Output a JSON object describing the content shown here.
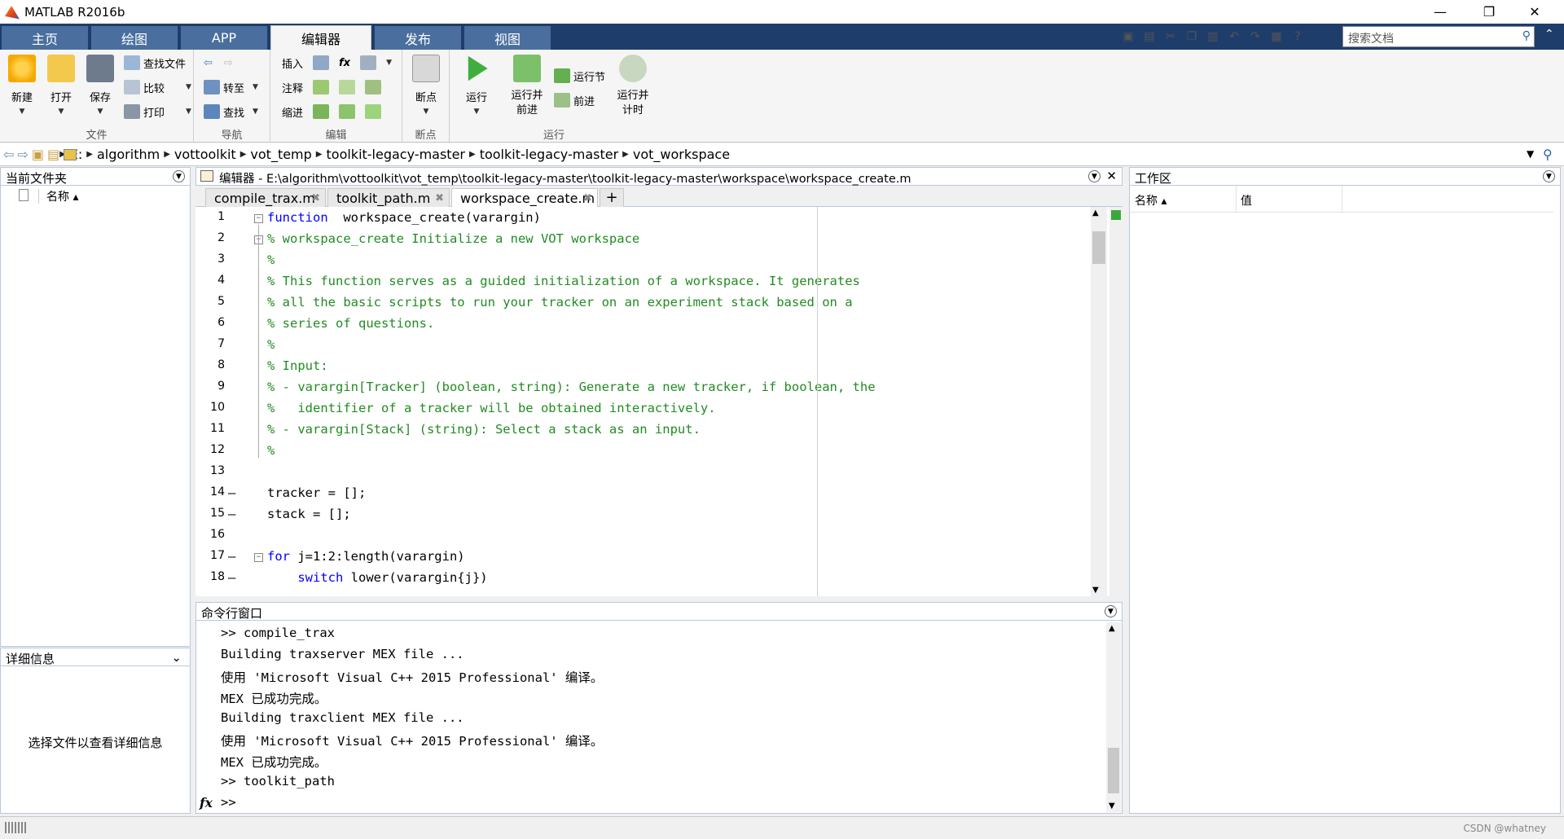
{
  "window": {
    "title": "MATLAB R2016b",
    "minimize": "—",
    "restore": "❐",
    "close": "✕"
  },
  "tabs": [
    {
      "label": "主页"
    },
    {
      "label": "绘图"
    },
    {
      "label": "APP"
    },
    {
      "label": "编辑器"
    },
    {
      "label": "发布"
    },
    {
      "label": "视图"
    }
  ],
  "search": {
    "placeholder": "搜索文档"
  },
  "ribbon": {
    "file": {
      "group": "文件",
      "new": "新建",
      "open": "打开",
      "save": "保存",
      "find_files": "查找文件",
      "compare": "比较",
      "print": "打印"
    },
    "navigate": {
      "group": "导航",
      "goto": "转至",
      "find": "查找"
    },
    "edit": {
      "group": "编辑",
      "insert": "插入",
      "comment": "注释",
      "indent": "缩进",
      "fx": "fx"
    },
    "breakpoints": {
      "group": "断点",
      "breakpoints": "断点"
    },
    "run": {
      "group": "运行",
      "run": "运行",
      "run_advance": "运行并\n前进",
      "run_section": "运行节",
      "advance": "前进",
      "run_time": "运行并\n计时"
    }
  },
  "address": {
    "segments": [
      "E:",
      "algorithm",
      "vottoolkit",
      "vot_temp",
      "toolkit-legacy-master",
      "toolkit-legacy-master",
      "vot_workspace"
    ]
  },
  "current_folder": {
    "title": "当前文件夹",
    "col_name": "名称 ▴"
  },
  "details": {
    "title": "详细信息",
    "message": "选择文件以查看详细信息"
  },
  "editor": {
    "title": "编辑器 - E:\\algorithm\\vottoolkit\\vot_temp\\toolkit-legacy-master\\toolkit-legacy-master\\workspace\\workspace_create.m",
    "tabs": [
      "compile_trax.m",
      "toolkit_path.m",
      "workspace_create.m"
    ],
    "add_tab": "+",
    "lines": [
      {
        "n": "1",
        "dash": "",
        "parts": [
          [
            "kw",
            "function"
          ],
          [
            "",
            "  workspace_create(varargin)"
          ]
        ]
      },
      {
        "n": "2",
        "dash": "",
        "parts": [
          [
            "cm",
            "% workspace_create Initialize a new VOT workspace"
          ]
        ]
      },
      {
        "n": "3",
        "dash": "",
        "parts": [
          [
            "cm",
            "%"
          ]
        ]
      },
      {
        "n": "4",
        "dash": "",
        "parts": [
          [
            "cm",
            "% This function serves as a guided initialization of a workspace. It generates"
          ]
        ]
      },
      {
        "n": "5",
        "dash": "",
        "parts": [
          [
            "cm",
            "% all the basic scripts to run your tracker on an experiment stack based on a"
          ]
        ]
      },
      {
        "n": "6",
        "dash": "",
        "parts": [
          [
            "cm",
            "% series of questions."
          ]
        ]
      },
      {
        "n": "7",
        "dash": "",
        "parts": [
          [
            "cm",
            "%"
          ]
        ]
      },
      {
        "n": "8",
        "dash": "",
        "parts": [
          [
            "cm",
            "% Input:"
          ]
        ]
      },
      {
        "n": "9",
        "dash": "",
        "parts": [
          [
            "cm",
            "% - varargin[Tracker] (boolean, string): Generate a new tracker, if boolean, the"
          ]
        ]
      },
      {
        "n": "10",
        "dash": "",
        "parts": [
          [
            "cm",
            "%   identifier of a tracker will be obtained interactively."
          ]
        ]
      },
      {
        "n": "11",
        "dash": "",
        "parts": [
          [
            "cm",
            "% - varargin[Stack] (string): Select a stack as an input."
          ]
        ]
      },
      {
        "n": "12",
        "dash": "",
        "parts": [
          [
            "cm",
            "%"
          ]
        ]
      },
      {
        "n": "13",
        "dash": "",
        "parts": [
          [
            "",
            ""
          ]
        ]
      },
      {
        "n": "14",
        "dash": "—",
        "parts": [
          [
            "",
            "tracker = [];"
          ]
        ]
      },
      {
        "n": "15",
        "dash": "—",
        "parts": [
          [
            "",
            "stack = [];"
          ]
        ]
      },
      {
        "n": "16",
        "dash": "",
        "parts": [
          [
            "",
            ""
          ]
        ]
      },
      {
        "n": "17",
        "dash": "—",
        "parts": [
          [
            "kw",
            "for"
          ],
          [
            "",
            " j=1:2:length(varargin)"
          ]
        ]
      },
      {
        "n": "18",
        "dash": "—",
        "parts": [
          [
            "",
            "    "
          ],
          [
            "kw",
            "switch"
          ],
          [
            "",
            " lower(varargin{j})"
          ]
        ]
      }
    ]
  },
  "command_window": {
    "title": "命令行窗口",
    "lines": [
      ">> compile_trax",
      "Building traxserver MEX file ...",
      "使用 'Microsoft Visual C++ 2015 Professional' 编译。",
      "MEX 已成功完成。",
      "Building traxclient MEX file ...",
      "使用 'Microsoft Visual C++ 2015 Professional' 编译。",
      "MEX 已成功完成。",
      ">> toolkit_path",
      ">>"
    ],
    "fx": "fx"
  },
  "workspace": {
    "title": "工作区",
    "col_name": "名称 ▴",
    "col_value": "值"
  },
  "watermark": "CSDN @whatney"
}
